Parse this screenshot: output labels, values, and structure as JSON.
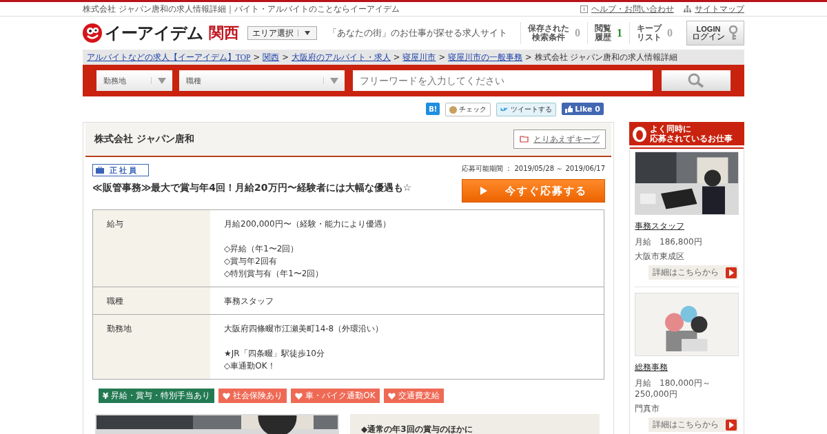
{
  "top_bar": {
    "page_title": "株式会社 ジャパン唐和の求人情報詳細｜バイト・アルバイトのことならイーアイデム",
    "links": [
      "ヘルプ・お問い合わせ",
      "サイトマップ"
    ]
  },
  "header": {
    "logo": "イーアイデム",
    "region": "関西",
    "area_select": "エリア選択",
    "tagline": "「あなたの街」のお仕事が探せる求人サイト",
    "counters": [
      {
        "label": [
          "保存された",
          "検索条件"
        ],
        "count": "0",
        "highlighted": false
      },
      {
        "label": [
          "閲覧",
          "履歴"
        ],
        "count": "1",
        "highlighted": true
      },
      {
        "label": [
          "キープ",
          "リスト"
        ],
        "count": "0",
        "highlighted": false
      }
    ],
    "login": {
      "label": "LOGIN",
      "sub": "ログイン"
    }
  },
  "breadcrumb": [
    {
      "text": "アルバイトなどの求人【イーアイデム】TOP",
      "link": true
    },
    {
      "separator": ">",
      "text": "関西",
      "link": true
    },
    {
      "separator": ">",
      "text": "大阪府のアルバイト・求人",
      "link": true
    },
    {
      "separator": ">",
      "text": "寝屋川市",
      "link": true
    },
    {
      "separator": ">",
      "text": "寝屋川市の一般事務",
      "link": true
    },
    {
      "separator": ">",
      "text": "株式会社 ジャパン唐和の求人情報詳細",
      "link": false
    }
  ],
  "search": {
    "selects": [
      "勤務地",
      "職種"
    ],
    "placeholder": "フリーワードを入力してください"
  },
  "social": [
    {
      "kind": "hatena",
      "text": "B!"
    },
    {
      "kind": "mixi",
      "text": "チェック"
    },
    {
      "kind": "tweet",
      "text": "ツイートする"
    },
    {
      "kind": "like",
      "text": "Like 0"
    }
  ],
  "job": {
    "company": "株式会社 ジャパン唐和",
    "keep": "とりあえずキープ",
    "employment": "正社員",
    "period": "応募可能期間 ： 2019/05/28 ～ 2019/06/17",
    "title": "≪販管事務≫最大で賞与年4回！月給20万円〜経験者には大幅な優遇も☆",
    "apply": "今すぐ応募する",
    "details": [
      {
        "label": "給与",
        "value": [
          [
            "月給200,000円〜（経験・能力により優遇）"
          ],
          [
            "◇昇給（年1〜2回）",
            "◇賞与年2回有",
            "◇特別賞与有（年1〜2回）"
          ]
        ]
      },
      {
        "label": "職種",
        "value": [
          [
            "事務スタッフ"
          ]
        ]
      },
      {
        "label": "勤務地",
        "value": [
          [
            "大阪府四條畷市江瀬美町14-8（外環沿い）"
          ],
          [
            "★JR「四条畷」駅徒歩10分",
            "◇車通勤OK！"
          ]
        ]
      }
    ],
    "tags": [
      {
        "kind": "money",
        "symbol": "¥",
        "text": "昇給・賞与・特別手当あり"
      },
      {
        "kind": "heart",
        "text": "社会保険あり"
      },
      {
        "kind": "heart",
        "text": "車・バイク通勤OK"
      },
      {
        "kind": "heart",
        "text": "交通費支給"
      }
    ],
    "note": "◆通常の年3回の賞与のほかに"
  },
  "sidebar": {
    "title": [
      "よく同時に",
      "応募されているお仕事"
    ],
    "jobs": [
      {
        "kind": "picture",
        "title": "事務スタッフ",
        "salary": "月給　186,800円",
        "location": "大阪市東成区",
        "more": "詳細はこちらから"
      },
      {
        "kind": "picture",
        "title": "総務事務",
        "salary": "月給　180,000円～250,000円",
        "location": "門真市",
        "more": "詳細はこちらから"
      }
    ]
  }
}
